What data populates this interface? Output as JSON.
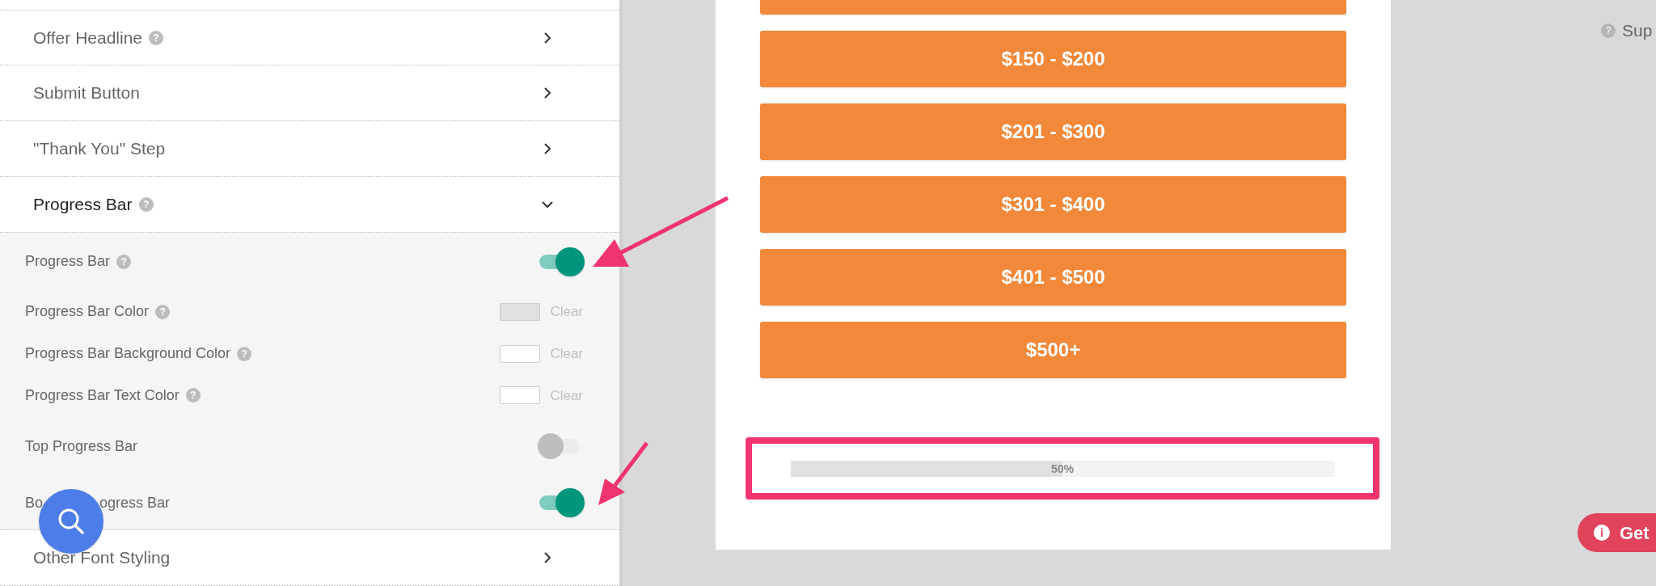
{
  "sections_above": [
    {
      "title": "Offer Headline",
      "help": "?",
      "expanded": false
    },
    {
      "title": "Submit Button",
      "expanded": false
    },
    {
      "title": "\"Thank You\" Step",
      "expanded": false
    },
    {
      "title": "Progress Bar",
      "help": "?",
      "expanded": true
    }
  ],
  "progress_settings": [
    {
      "kind": "toggle",
      "label": "Progress Bar",
      "help": "?",
      "on": true
    },
    {
      "kind": "color",
      "label": "Progress Bar Color",
      "help": "?",
      "color": "#e0e0e0",
      "clear": "Clear"
    },
    {
      "kind": "color",
      "label": "Progress Bar Background Color",
      "help": "?",
      "color": "#ffffff",
      "clear": "Clear"
    },
    {
      "kind": "color",
      "label": "Progress Bar Text Color",
      "help": "?",
      "color": "#ffffff",
      "clear": "Clear"
    },
    {
      "kind": "toggle",
      "label": "Top Progress Bar",
      "on": false
    },
    {
      "kind": "toggle",
      "label_parts": [
        "Bo",
        "ogress Bar"
      ],
      "on": true
    }
  ],
  "sections_below": [
    {
      "title": "Other Font Styling",
      "expanded": false
    }
  ],
  "preview": {
    "options": [
      "$150 - $200",
      "$201 - $300",
      "$301 - $400",
      "$401 - $500",
      "$500+"
    ],
    "progress": {
      "level": 0.5,
      "label": "50%"
    }
  },
  "right_panel": {
    "help": "?",
    "help_label": "Sup",
    "get_icon": "i",
    "get_button": "Get"
  }
}
